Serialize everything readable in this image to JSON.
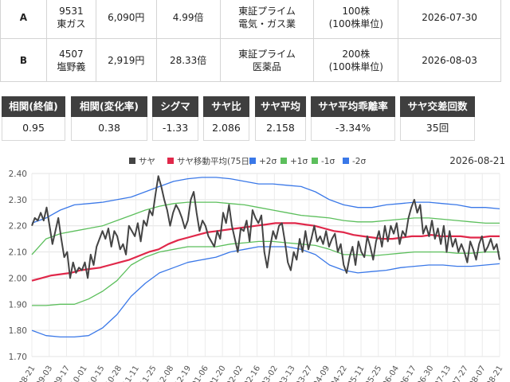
{
  "stocks": [
    {
      "label": "A",
      "code": "9531",
      "name": "東ガス",
      "price": "6,090円",
      "ratio": "4.99倍",
      "market": "東証プライム",
      "sector": "電気・ガス業",
      "shares": "100株",
      "unit": "(100株単位)",
      "date": "2026-07-30"
    },
    {
      "label": "B",
      "code": "4507",
      "name": "塩野義",
      "price": "2,919円",
      "ratio": "28.33倍",
      "market": "東証プライム",
      "sector": "医薬品",
      "shares": "200株",
      "unit": "(100株単位)",
      "date": "2026-08-03"
    }
  ],
  "stats": [
    {
      "label": "相関(終値)",
      "value": "0.95"
    },
    {
      "label": "相関(変化率)",
      "value": "0.38"
    },
    {
      "label": "シグマ",
      "value": "-1.33"
    },
    {
      "label": "サヤ比",
      "value": "2.086"
    },
    {
      "label": "サヤ平均",
      "value": "2.158"
    },
    {
      "label": "サヤ平均乖離率",
      "value": "-3.34%"
    },
    {
      "label": "サヤ交差回数",
      "value": "35回"
    }
  ],
  "chart_data": {
    "type": "line",
    "date_label": "2026-08-21",
    "ylim": [
      1.7,
      2.4
    ],
    "y_ticks": [
      "1.70",
      "1.80",
      "1.90",
      "2.00",
      "2.10",
      "2.20",
      "2.30",
      "2.40"
    ],
    "x_ticks": [
      "08-21",
      "09-03",
      "09-17",
      "10-01",
      "10-15",
      "10-28",
      "11-11",
      "11-25",
      "12-08",
      "12-19",
      "01-06",
      "01-20",
      "02-02",
      "02-16",
      "03-02",
      "03-13",
      "03-27",
      "04-09",
      "04-22",
      "05-11",
      "05-25",
      "06-04",
      "06-17",
      "06-30",
      "07-13",
      "07-27",
      "08-07",
      "08-21"
    ],
    "legend": [
      {
        "name": "サヤ",
        "color": "#444444"
      },
      {
        "name": "サヤ移動平均(75日)",
        "color": "#e0284a"
      },
      {
        "name": "+2σ",
        "color": "#3a78e8"
      },
      {
        "name": "+1σ",
        "color": "#5cbf5c"
      },
      {
        "name": "-1σ",
        "color": "#5cbf5c"
      },
      {
        "name": "-2σ",
        "color": "#3a78e8"
      }
    ],
    "series": [
      {
        "name": "サヤ",
        "values": [
          2.2,
          2.23,
          2.22,
          2.25,
          2.22,
          2.27,
          2.2,
          2.13,
          2.18,
          2.23,
          2.15,
          2.08,
          2.1,
          2.0,
          2.06,
          2.02,
          2.04,
          2.03,
          2.06,
          2.0,
          2.09,
          2.05,
          2.12,
          2.15,
          2.18,
          2.15,
          2.19,
          2.12,
          2.18,
          2.16,
          2.11,
          2.13,
          2.09,
          2.2,
          2.18,
          2.16,
          2.21,
          2.14,
          2.22,
          2.2,
          2.26,
          2.24,
          2.32,
          2.39,
          2.35,
          2.3,
          2.26,
          2.2,
          2.25,
          2.28,
          2.26,
          2.23,
          2.19,
          2.22,
          2.3,
          2.33,
          2.25,
          2.18,
          2.22,
          2.2,
          2.16,
          2.14,
          2.12,
          2.18,
          2.15,
          2.25,
          2.21,
          2.28,
          2.2,
          2.15,
          2.1,
          2.19,
          2.18,
          2.22,
          2.14,
          2.26,
          2.23,
          2.21,
          2.24,
          2.1,
          2.04,
          2.12,
          2.18,
          2.15,
          2.2,
          2.21,
          2.14,
          2.06,
          2.03,
          2.1,
          2.07,
          2.15,
          2.1,
          2.18,
          2.11,
          2.15,
          2.2,
          2.14,
          2.16,
          2.13,
          2.18,
          2.12,
          2.15,
          2.17,
          2.1,
          2.13,
          2.05,
          2.02,
          2.08,
          2.12,
          2.05,
          2.14,
          2.1,
          2.08,
          2.16,
          2.12,
          2.07,
          2.14,
          2.18,
          2.12,
          2.2,
          2.14,
          2.2,
          2.17,
          2.21,
          2.13,
          2.18,
          2.16,
          2.23,
          2.27,
          2.3,
          2.25,
          2.28,
          2.17,
          2.2,
          2.16,
          2.22,
          2.15,
          2.19,
          2.13,
          2.2,
          2.1,
          2.18,
          2.12,
          2.15,
          2.1,
          2.13,
          2.1,
          2.06,
          2.14,
          2.11,
          2.07,
          2.13,
          2.16,
          2.1,
          2.12,
          2.15,
          2.11,
          2.13,
          2.07
        ]
      },
      {
        "name": "サヤ移動平均(75日)",
        "values": [
          1.99,
          2.0,
          2.01,
          2.015,
          2.02,
          2.03,
          2.035,
          2.04,
          2.05,
          2.06,
          2.07,
          2.085,
          2.1,
          2.11,
          2.13,
          2.145,
          2.155,
          2.165,
          2.175,
          2.18,
          2.185,
          2.19,
          2.195,
          2.2,
          2.205,
          2.21,
          2.21,
          2.21,
          2.205,
          2.2,
          2.19,
          2.18,
          2.175,
          2.165,
          2.16,
          2.155,
          2.15,
          2.15,
          2.155,
          2.16,
          2.16,
          2.165,
          2.16,
          2.16,
          2.16,
          2.155,
          2.155,
          2.16,
          2.16
        ]
      },
      {
        "name": "+2σ",
        "values": [
          2.21,
          2.23,
          2.26,
          2.28,
          2.285,
          2.29,
          2.3,
          2.31,
          2.33,
          2.35,
          2.37,
          2.38,
          2.385,
          2.385,
          2.38,
          2.37,
          2.36,
          2.36,
          2.355,
          2.35,
          2.33,
          2.3,
          2.28,
          2.27,
          2.27,
          2.28,
          2.285,
          2.29,
          2.29,
          2.285,
          2.28,
          2.27,
          2.27,
          2.265
        ]
      },
      {
        "name": "+1σ",
        "values": [
          2.09,
          2.15,
          2.17,
          2.18,
          2.19,
          2.2,
          2.22,
          2.24,
          2.26,
          2.275,
          2.285,
          2.29,
          2.29,
          2.29,
          2.285,
          2.28,
          2.27,
          2.26,
          2.25,
          2.24,
          2.235,
          2.23,
          2.22,
          2.215,
          2.215,
          2.22,
          2.225,
          2.23,
          2.23,
          2.225,
          2.22,
          2.215,
          2.21,
          2.21
        ]
      },
      {
        "name": "-1σ",
        "values": [
          1.895,
          1.895,
          1.9,
          1.9,
          1.92,
          1.95,
          1.99,
          2.05,
          2.08,
          2.1,
          2.11,
          2.12,
          2.12,
          2.12,
          2.13,
          2.135,
          2.14,
          2.14,
          2.135,
          2.13,
          2.125,
          2.11,
          2.09,
          2.09,
          2.085,
          2.09,
          2.095,
          2.1,
          2.1,
          2.1,
          2.095,
          2.095,
          2.1,
          2.1
        ]
      },
      {
        "name": "-2σ",
        "values": [
          1.8,
          1.78,
          1.775,
          1.775,
          1.78,
          1.81,
          1.86,
          1.93,
          1.98,
          2.02,
          2.04,
          2.06,
          2.07,
          2.08,
          2.1,
          2.11,
          2.12,
          2.12,
          2.12,
          2.11,
          2.09,
          2.05,
          2.03,
          2.02,
          2.025,
          2.03,
          2.04,
          2.045,
          2.05,
          2.05,
          2.045,
          2.045,
          2.05,
          2.055
        ]
      }
    ]
  }
}
